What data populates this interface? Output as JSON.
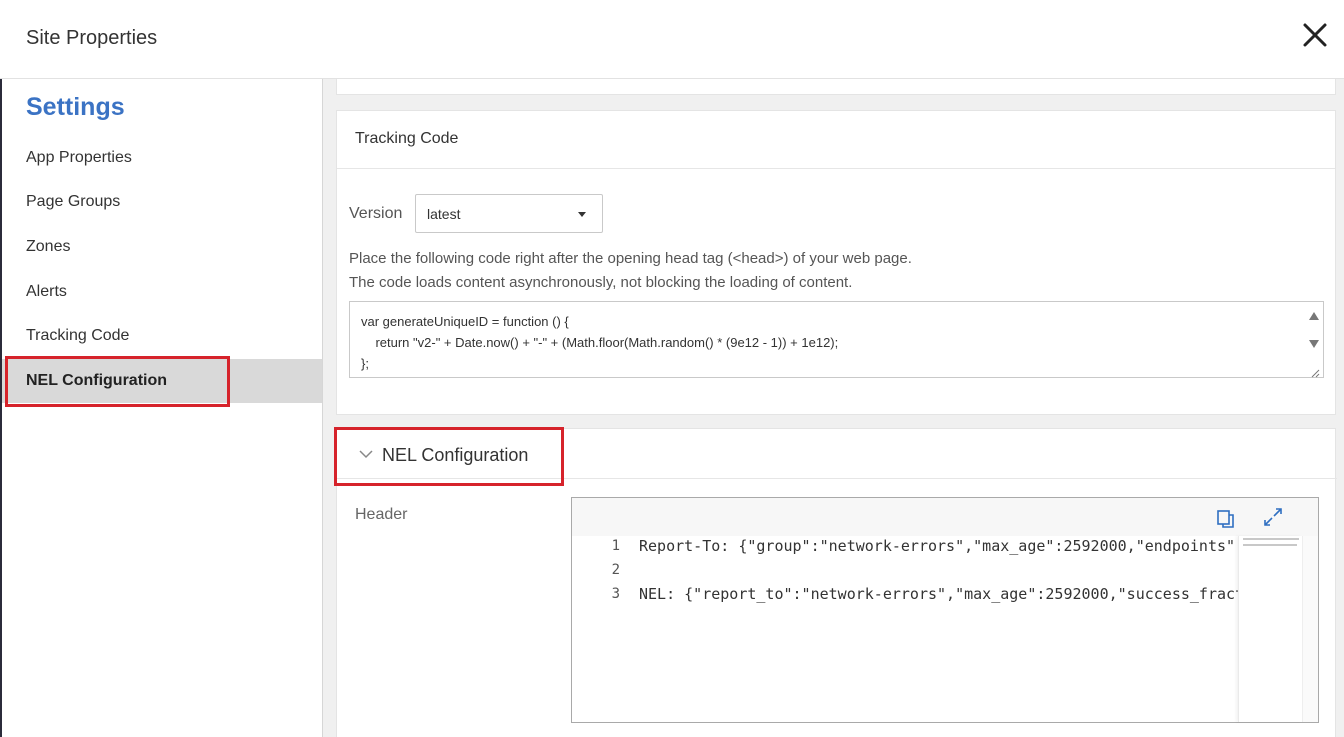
{
  "window": {
    "title": "Site Properties"
  },
  "sidebar": {
    "heading": "Settings",
    "items": [
      {
        "label": "App Properties"
      },
      {
        "label": "Page Groups"
      },
      {
        "label": "Zones"
      },
      {
        "label": "Alerts"
      },
      {
        "label": "Tracking Code"
      },
      {
        "label": "NEL Configuration",
        "active": true
      }
    ]
  },
  "tracking": {
    "title": "Tracking Code",
    "version_label": "Version",
    "version_value": "latest",
    "desc_line1": "Place the following code right after the opening head tag (<head>) of your web page.",
    "desc_line2": "The code loads content asynchronously, not blocking the loading of content.",
    "code_lines": [
      "var generateUniqueID = function () {",
      "    return \"v2-\" + Date.now() + \"-\" + (Math.floor(Math.random() * (9e12 - 1)) + 1e12);",
      "};"
    ]
  },
  "nel": {
    "title": "NEL Configuration",
    "header_label": "Header",
    "editor_lines": [
      {
        "num": "1",
        "text": "Report-To: {\"group\":\"network-errors\",\"max_age\":2592000,\"endpoints\":"
      },
      {
        "num": "2",
        "text": ""
      },
      {
        "num": "3",
        "text": "NEL: {\"report_to\":\"network-errors\",\"max_age\":2592000,\"success_fraction\":"
      }
    ]
  },
  "colors": {
    "accent": "#3b73c4",
    "highlight_box": "#d6232b",
    "active_item_bg": "#d9d9d9"
  },
  "icons": [
    "close-icon",
    "chevron-down-icon",
    "copy-icon",
    "expand-icon",
    "caret-down-icon"
  ]
}
